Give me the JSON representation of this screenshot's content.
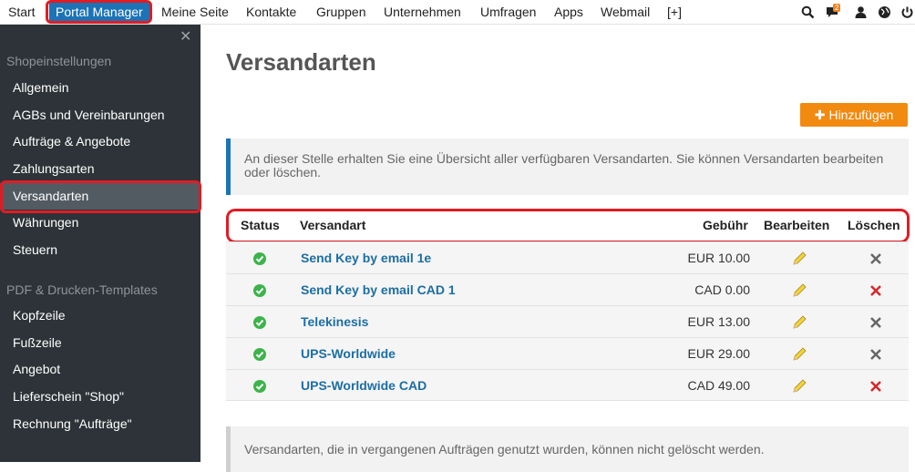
{
  "topnav": {
    "items": [
      "Start",
      "Portal Manager",
      "Meine Seite",
      "Kontakte",
      "Gruppen",
      "Unternehmen",
      "Umfragen",
      "Apps",
      "Webmail",
      "[+]"
    ],
    "badge_count": "2",
    "icons": [
      "search-icon",
      "chat-icon",
      "user-icon",
      "globe-icon",
      "power-icon"
    ]
  },
  "sidebar": {
    "close_glyph": "✕",
    "section1": "Shopeinstellungen",
    "items1": [
      "Allgemein",
      "AGBs und Vereinbarungen",
      "Aufträge & Angebote",
      "Zahlungsarten",
      "Versandarten",
      "Währungen",
      "Steuern"
    ],
    "section2": "PDF & Drucken-Templates",
    "items2": [
      "Kopfzeile",
      "Fußzeile",
      "Angebot",
      "Lieferschein \"Shop\"",
      "Rechnung \"Aufträge\""
    ],
    "active_item": "Versandarten"
  },
  "main": {
    "title": "Versandarten",
    "add_button": "Hinzufügen",
    "info": "An dieser Stelle erhalten Sie eine Übersicht aller verfügbaren Versandarten. Sie können Versandarten bearbeiten oder löschen.",
    "footer_note": "Versandarten, die in vergangenen Aufträgen genutzt wurden, können nicht gelöscht werden."
  },
  "table": {
    "headers": {
      "status": "Status",
      "name": "Versandart",
      "fee": "Gebühr",
      "edit": "Bearbeiten",
      "delete": "Löschen"
    },
    "rows": [
      {
        "name": "Send Key by email 1e",
        "fee": "EUR 10.00",
        "deletable": false
      },
      {
        "name": "Send Key by email CAD 1",
        "fee": "CAD 0.00",
        "deletable": true
      },
      {
        "name": "Telekinesis",
        "fee": "EUR 13.00",
        "deletable": false
      },
      {
        "name": "UPS-Worldwide",
        "fee": "EUR 29.00",
        "deletable": false
      },
      {
        "name": "UPS-Worldwide CAD",
        "fee": "CAD 49.00",
        "deletable": true
      }
    ]
  },
  "colors": {
    "accent": "#1c73b5",
    "add_button": "#f28a10",
    "highlight": "#e01c24",
    "status_ok": "#3cb44b",
    "delete_active": "#d9262c",
    "delete_disabled": "#666666"
  }
}
